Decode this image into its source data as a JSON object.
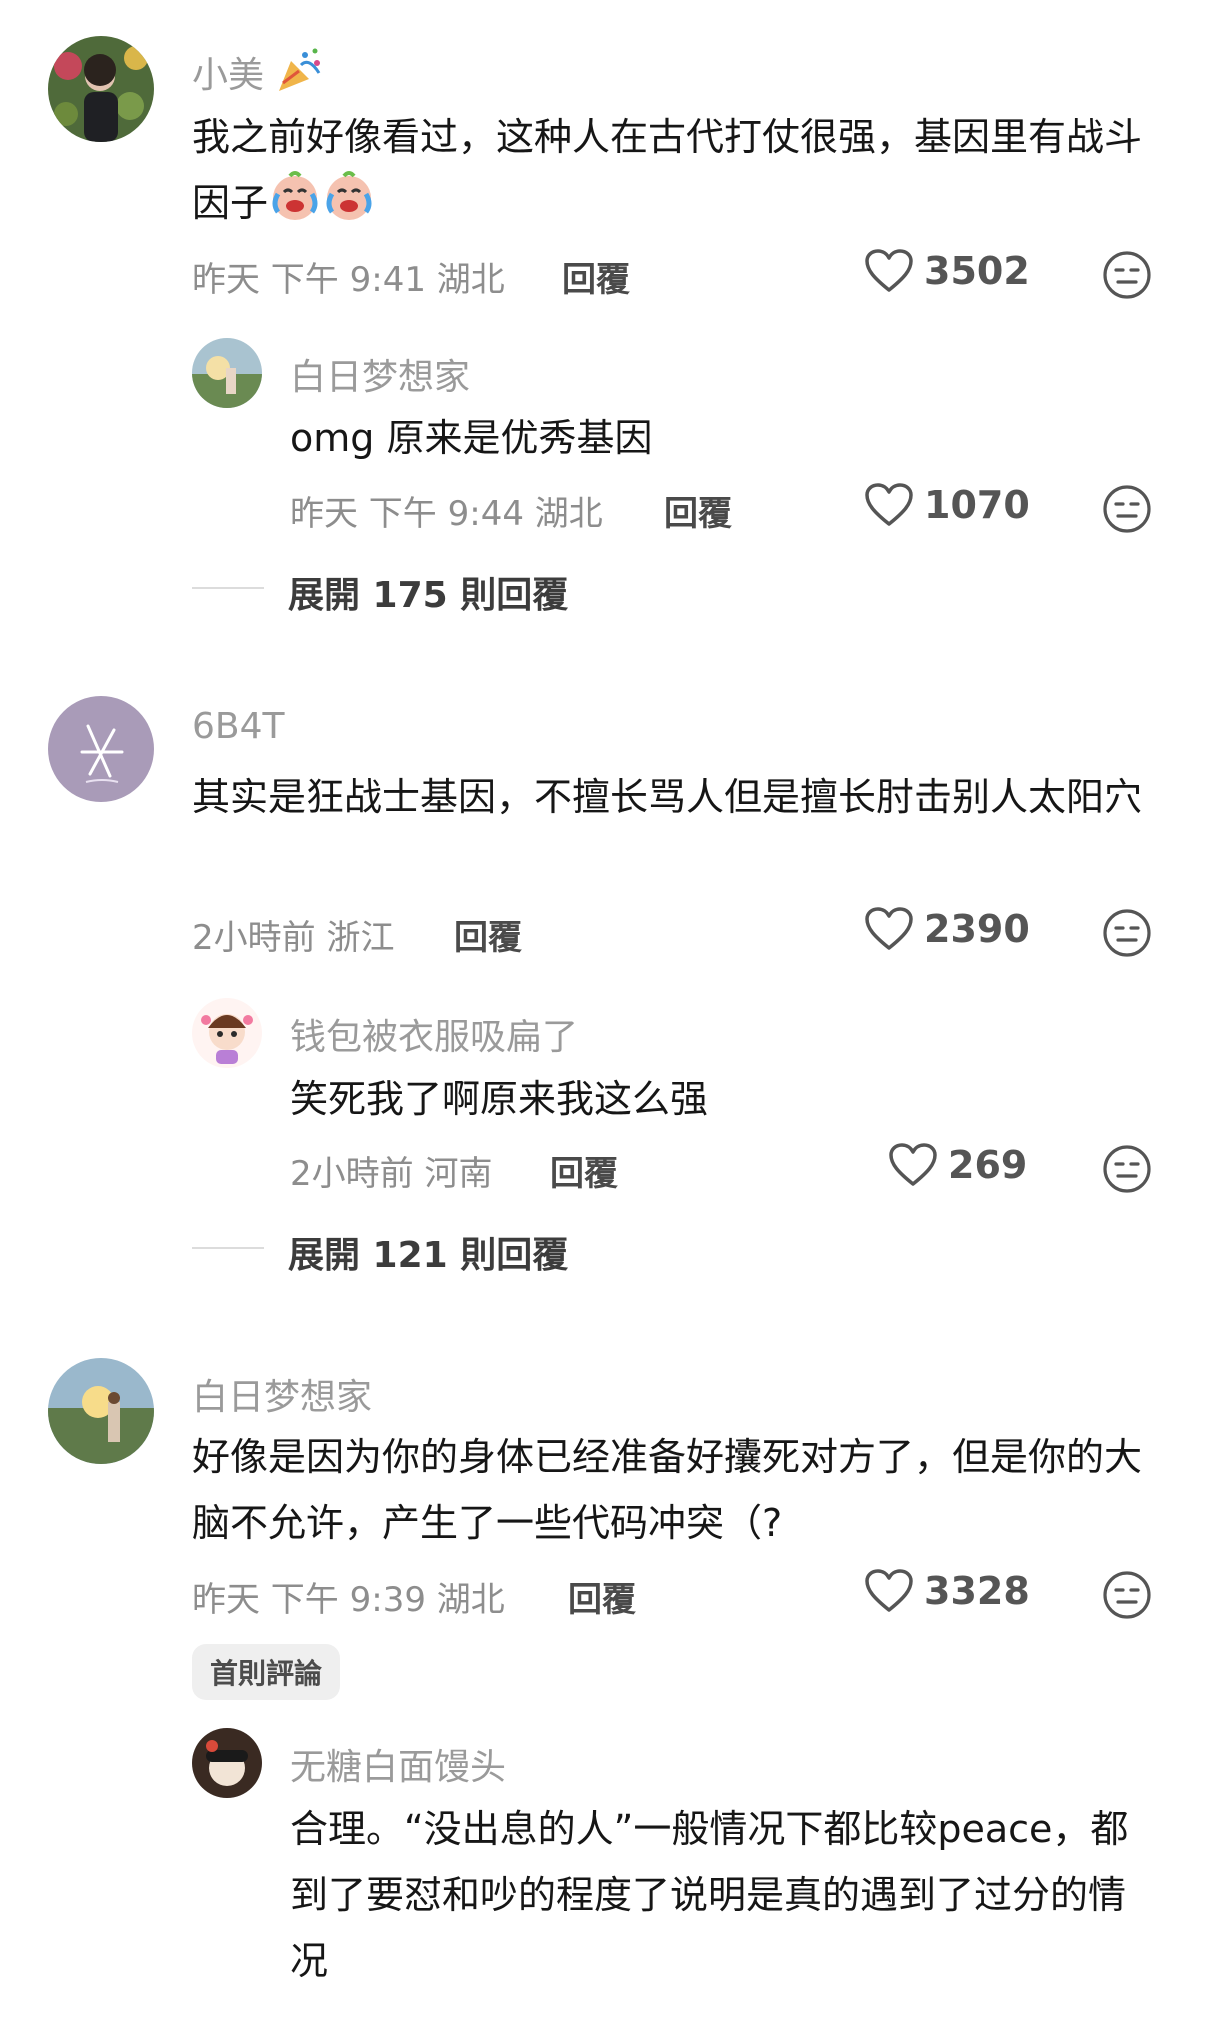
{
  "comments": [
    {
      "username": "小美",
      "text": "我之前好像看过，这种人在古代打仗很强，基因里有战斗因子",
      "meta": "昨天 下午 9:41 湖北",
      "reply_label": "回覆",
      "likes": "3502",
      "reply": {
        "username": "白日梦想家",
        "text": "omg 原来是优秀基因",
        "meta": "昨天 下午 9:44 湖北",
        "reply_label": "回覆",
        "likes": "1070"
      },
      "expand": "展開 175 則回覆"
    },
    {
      "username": "6B4T",
      "text": "其实是狂战士基因，不擅长骂人但是擅长肘击别人太阳穴",
      "meta": "2小時前 浙江",
      "reply_label": "回覆",
      "likes": "2390",
      "reply": {
        "username": "钱包被衣服吸扁了",
        "text": "笑死我了啊原来我这么强",
        "meta": "2小時前 河南",
        "reply_label": "回覆",
        "likes": "269"
      },
      "expand": "展開 121 則回覆"
    },
    {
      "username": "白日梦想家",
      "text": "好像是因为你的身体已经准备好攮死对方了，但是你的大脑不允许，产生了一些代码冲突（?",
      "meta": "昨天 下午 9:39 湖北",
      "reply_label": "回覆",
      "likes": "3328",
      "badge": "首則評論",
      "reply": {
        "username": "无糖白面馒头",
        "text": "合理。“没出息的人”一般情况下都比较peace，都到了要怼和吵的程度了说明是真的遇到了过分的情况"
      }
    }
  ],
  "icons": {
    "like": "heart-outline-icon",
    "react": "neutral-face-icon",
    "party": "party-popper-icon",
    "cry_laugh": "crying-laughing-emoji-icon"
  },
  "colors": {
    "username": "#9a9a9a",
    "meta": "#8d8d8d",
    "text": "#161616"
  }
}
